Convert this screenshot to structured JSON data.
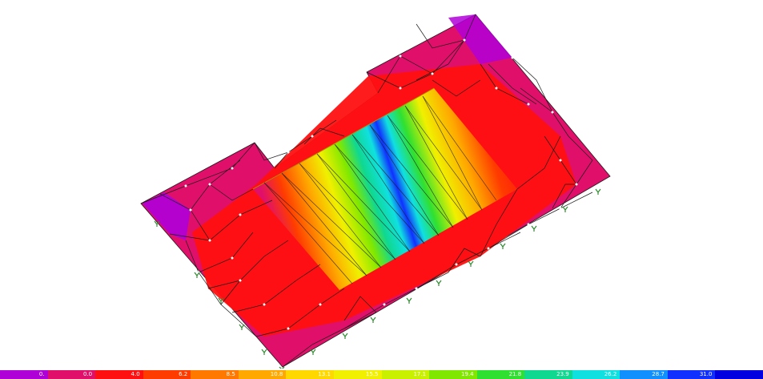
{
  "model": {
    "description": "",
    "view_colors": {
      "mesh_line": "#1a1a1a",
      "node": "#ffffff",
      "support": "#2e8b2e",
      "background": "#ffffff"
    }
  },
  "legend": {
    "colors": [
      "#b000d8",
      "#e0106a",
      "#ff1010",
      "#ff3c00",
      "#ff7800",
      "#ffa800",
      "#ffd800",
      "#f0f000",
      "#c8f000",
      "#80e800",
      "#30e030",
      "#10d890",
      "#10e0e0",
      "#1090ff",
      "#1030ff",
      "#0000e0"
    ],
    "ticks": [
      "0.",
      "0.0",
      "4.0",
      "6.2",
      "8.5",
      "10.8",
      "13.1",
      "15.5",
      "17.1",
      "19.4",
      "21.8",
      "23.9",
      "26.2",
      "28.7",
      "31.0",
      ""
    ]
  }
}
